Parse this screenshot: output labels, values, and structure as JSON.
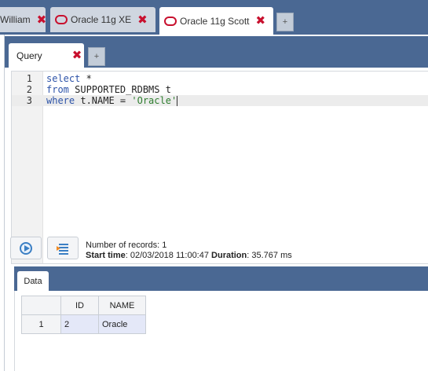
{
  "connection_tabs": [
    {
      "label": "William",
      "active": false,
      "icon": "none"
    },
    {
      "label": "Oracle 11g XE",
      "active": false,
      "icon": "oracle-icon"
    },
    {
      "label": "Oracle 11g Scott",
      "active": true,
      "icon": "oracle-icon"
    }
  ],
  "connection_add_label": "+",
  "query_tab": {
    "label": "Query"
  },
  "query_add_label": "+",
  "editor": {
    "lines": [
      {
        "num": "1",
        "kw": "select",
        "rest": " *"
      },
      {
        "num": "2",
        "kw": "from",
        "rest": " SUPPORTED_RDBMS t"
      },
      {
        "num": "3",
        "kw": "where",
        "rest": " t.NAME = ",
        "str": "'Oracle'"
      }
    ]
  },
  "status": {
    "records": "Number of records: 1",
    "start_label": "Start time",
    "start_value": ": 02/03/2018 11:00:47 ",
    "duration_label": "Duration",
    "duration_value": ": 35.767 ms"
  },
  "results_tab": {
    "label": "Data"
  },
  "table": {
    "headers": [
      "",
      "ID",
      "NAME"
    ],
    "rows": [
      [
        "1",
        "2",
        "Oracle"
      ]
    ]
  },
  "colors": {
    "header_bar": "#4a6893",
    "close": "#c8102e",
    "keyword": "#2d53a8",
    "string": "#2e7d2e"
  },
  "icons": [
    "close-icon",
    "oracle-icon",
    "run-icon",
    "explain-icon"
  ]
}
